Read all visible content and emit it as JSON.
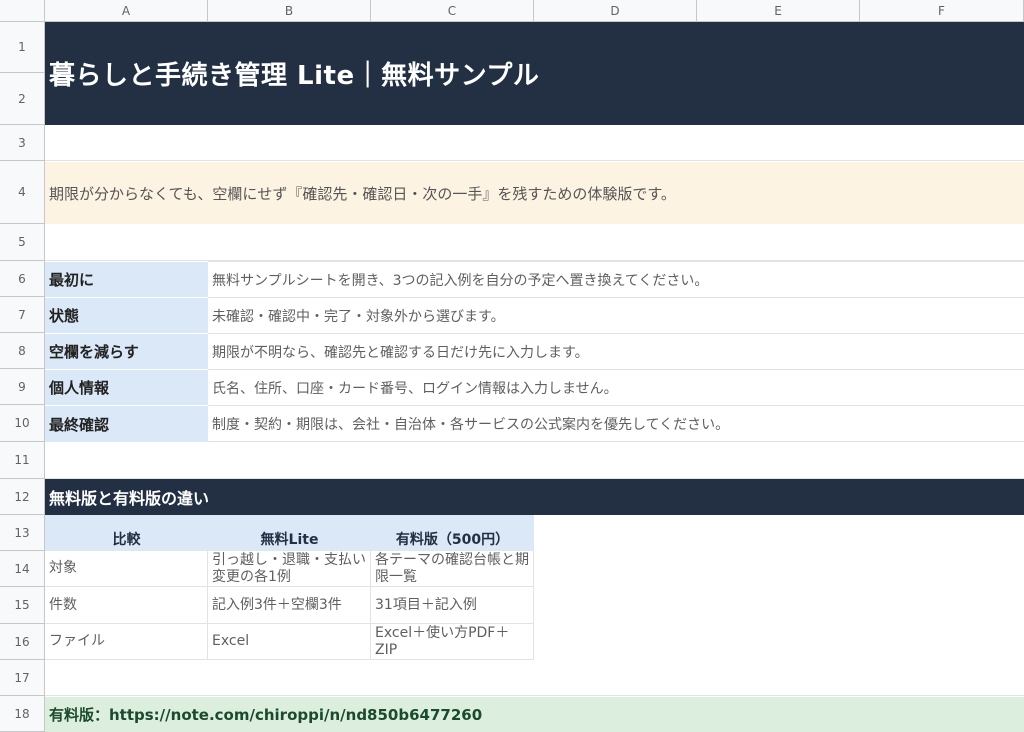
{
  "columns": [
    "A",
    "B",
    "C",
    "D",
    "E",
    "F"
  ],
  "rows": [
    "1",
    "2",
    "3",
    "4",
    "5",
    "6",
    "7",
    "8",
    "9",
    "10",
    "11",
    "12",
    "13",
    "14",
    "15",
    "16",
    "17",
    "18"
  ],
  "title": "暮らしと手続き管理 Lite｜無料サンプル",
  "intro": "期限が分からなくても、空欄にせず『確認先・確認日・次の一手』を残すための体験版です。",
  "guide": [
    {
      "label": "最初に",
      "text": "無料サンプルシートを開き、3つの記入例を自分の予定へ置き換えてください。"
    },
    {
      "label": "状態",
      "text": "未確認・確認中・完了・対象外から選びます。"
    },
    {
      "label": "空欄を減らす",
      "text": "期限が不明なら、確認先と確認する日だけ先に入力します。"
    },
    {
      "label": "個人情報",
      "text": "氏名、住所、口座・カード番号、ログイン情報は入力しません。"
    },
    {
      "label": "最終確認",
      "text": "制度・契約・期限は、会社・自治体・各サービスの公式案内を優先してください。"
    }
  ],
  "comparison": {
    "title": "無料版と有料版の違い",
    "headers": [
      "比較",
      "無料Lite",
      "有料版（500円）"
    ],
    "rows": [
      {
        "c0": "対象",
        "c1": "引っ越し・退職・支払い変更の各1例",
        "c2": "各テーマの確認台帳と期限一覧"
      },
      {
        "c0": "件数",
        "c1": "記入例3件＋空欄3件",
        "c2": "31項目＋記入例"
      },
      {
        "c0": "ファイル",
        "c1": "Excel",
        "c2": "Excel＋使い方PDF＋ZIP"
      }
    ]
  },
  "footer_link": "有料版：https://note.com/chiroppi/n/nd850b6477260",
  "colors": {
    "header_navy": "#233044",
    "intro_bg": "#fdf3e3",
    "label_bg": "#dbe8f8",
    "link_bg": "#dcefdf"
  }
}
